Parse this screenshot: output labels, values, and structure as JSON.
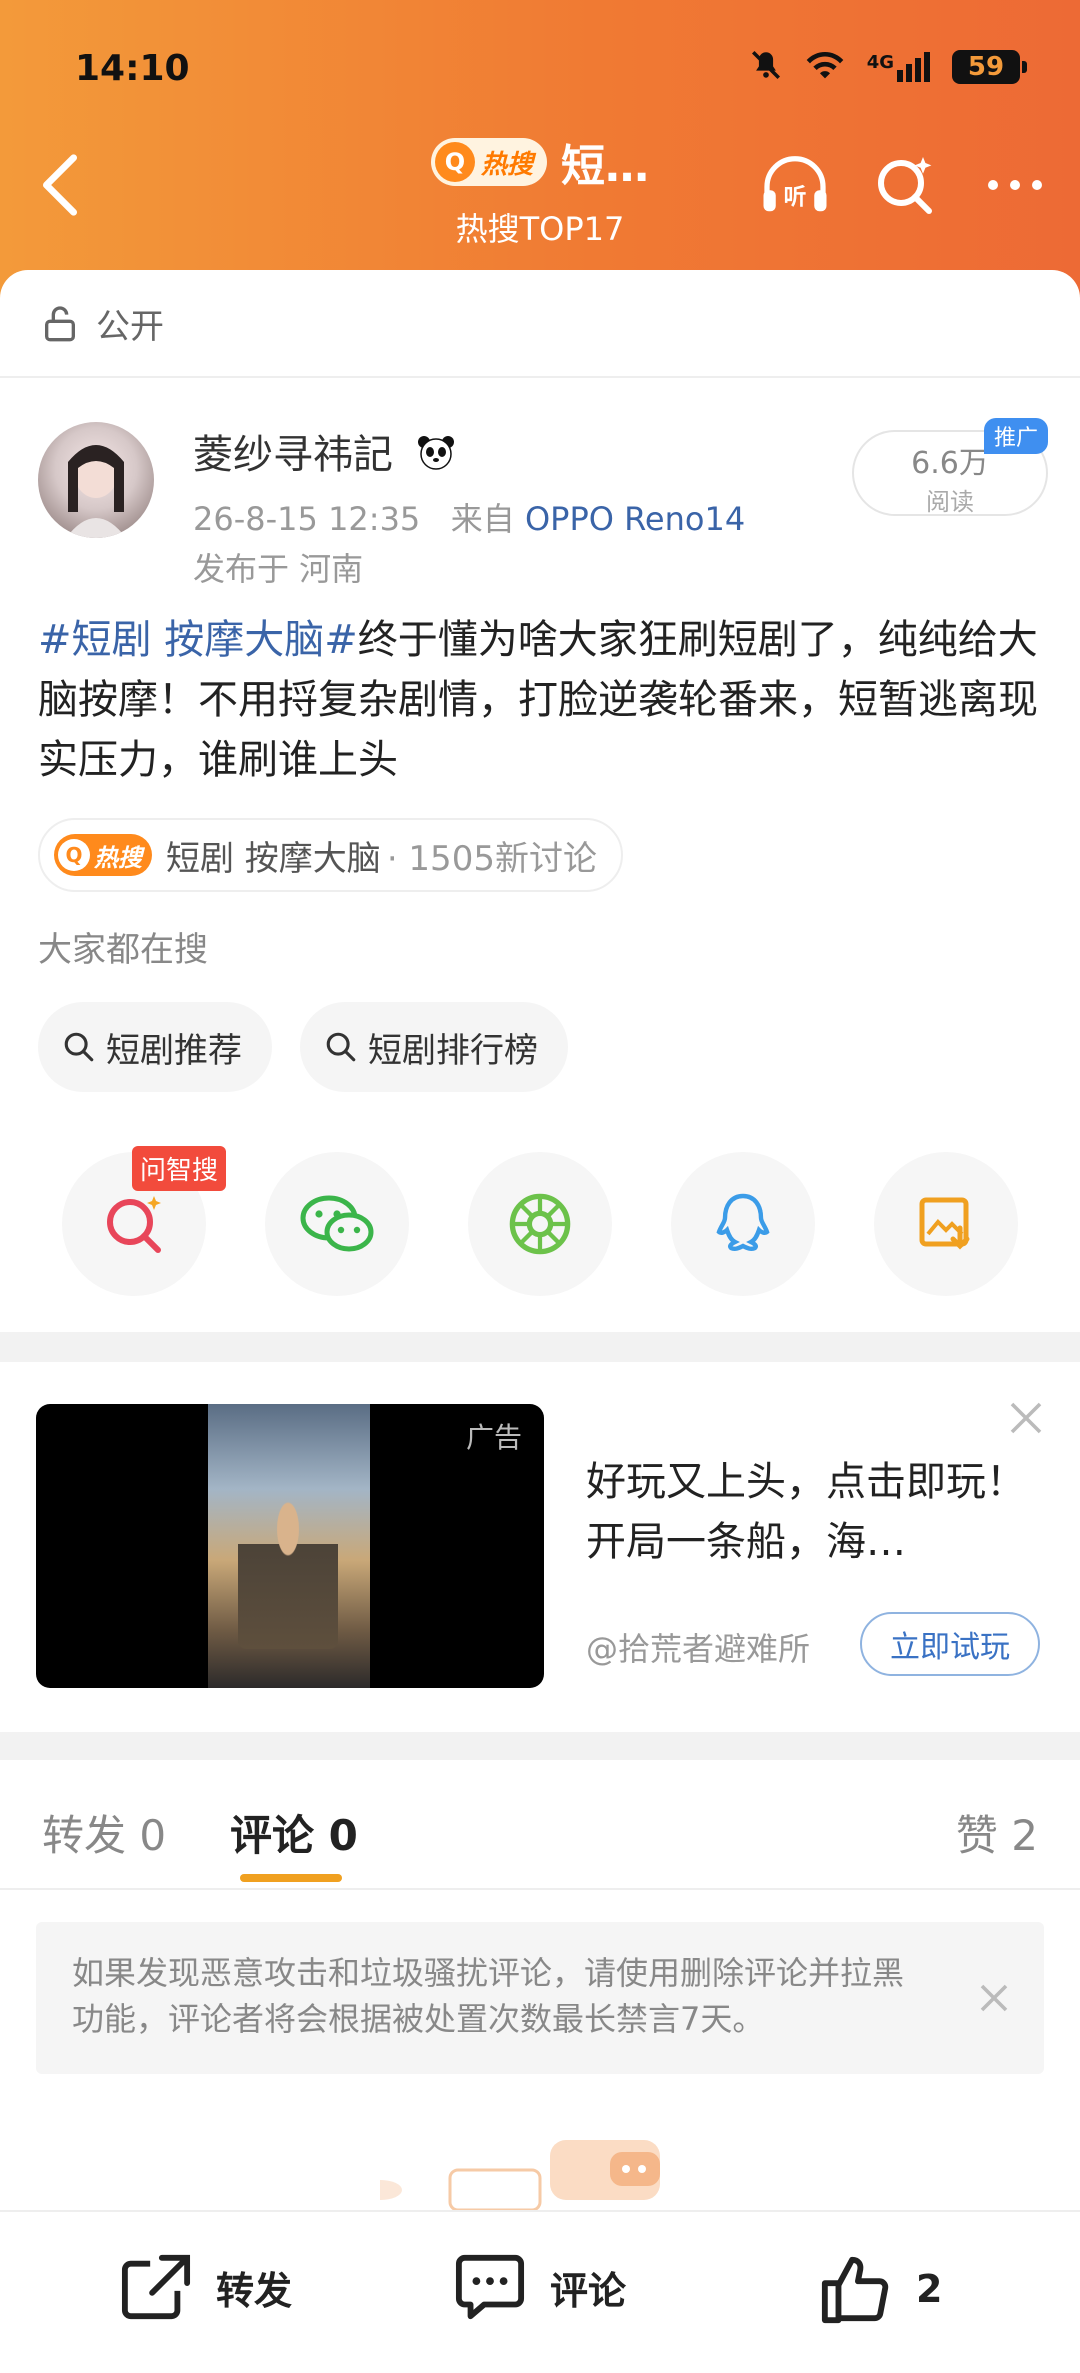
{
  "status_bar": {
    "time": "14:10",
    "network": "4G",
    "battery": "59"
  },
  "header": {
    "hot_badge": "热搜",
    "title": "短…",
    "subtitle": "热搜TOP17",
    "listen_label": "听"
  },
  "visibility": {
    "label": "公开"
  },
  "post": {
    "author": "菱纱寻祎記",
    "date": "26-8-15 12:35",
    "from_prefix": "来自",
    "device": "OPPO Reno14",
    "location": "发布于 河南",
    "views": "6.6万",
    "views_label": "阅读",
    "promo_tag": "推广",
    "hashtag": "#短剧 按摩大脑#",
    "body": "终于懂为啥大家狂刷短剧了，纯纯给大脑按摩！不用捋复杂剧情，打脸逆袭轮番来，短暂逃离现实压力，谁刷谁上头"
  },
  "hot_topic": {
    "badge": "热搜",
    "name": "短剧 按摩大脑",
    "discussions": "· 1505新讨论"
  },
  "searching": {
    "label": "大家都在搜",
    "items": [
      "短剧推荐",
      "短剧排行榜"
    ]
  },
  "share": {
    "ai_tag": "问智搜"
  },
  "ad": {
    "label": "广告",
    "text": "好玩又上头，点击即玩！开局一条船，海…",
    "source": "@拾荒者避难所",
    "cta": "立即试玩"
  },
  "tabs": {
    "repost": "转发 0",
    "comment": "评论 0",
    "like": "赞 2"
  },
  "notice": {
    "text": "如果发现恶意攻击和垃圾骚扰评论，请使用删除评论并拉黑功能，评论者将会根据被处置次数最长禁言7天。"
  },
  "bottom_bar": {
    "repost": "转发",
    "comment": "评论",
    "like_count": "2"
  },
  "colors": {
    "header_orange": "#f07a33",
    "link_blue": "#3a64a8",
    "accent_gold": "#f0a020"
  }
}
